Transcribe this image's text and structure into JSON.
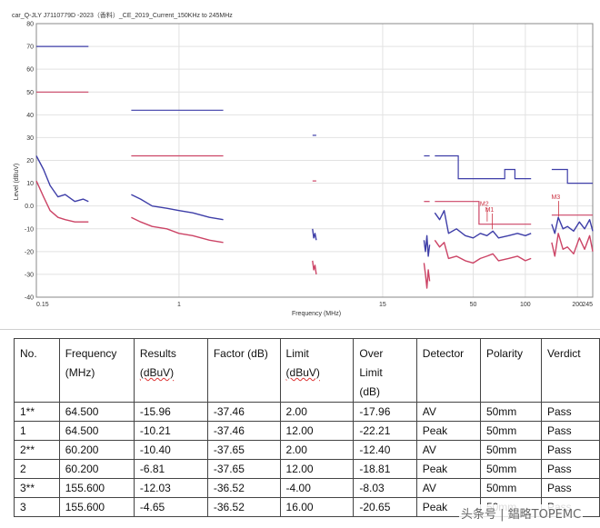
{
  "chart_data": {
    "type": "line",
    "title": "car_Q-JLY J7110779D -2023（香料）_CE_2019_Current_150KHz to 245MHz",
    "xlabel": "Frequency (MHz)",
    "ylabel": "Level (dBuV)",
    "xscale": "log",
    "xlim": [
      0.15,
      245
    ],
    "ylim": [
      -40,
      80
    ],
    "x_ticks": [
      0.15,
      1,
      15,
      50,
      100,
      200,
      245
    ],
    "x_tick_labels": [
      "0.15",
      "1",
      "15",
      "50",
      "100",
      "200",
      "245"
    ],
    "y_ticks": [
      -40,
      -30,
      -20,
      -10,
      0,
      10,
      20,
      30,
      40,
      50,
      60,
      70,
      80
    ],
    "y_tick_labels": [
      "-40",
      "-30",
      "-20",
      "-10",
      "0.0",
      "10",
      "20",
      "30",
      "40",
      "50",
      "60",
      "70",
      "80"
    ],
    "grid": true,
    "colors": {
      "peak": "#3e3ea8",
      "average": "#cc4466",
      "marker": "#cc3344"
    },
    "limit_segments": [
      {
        "series": "peak",
        "points": [
          [
            0.15,
            70
          ],
          [
            0.3,
            70
          ]
        ]
      },
      {
        "series": "average",
        "points": [
          [
            0.15,
            50
          ],
          [
            0.3,
            50
          ]
        ]
      },
      {
        "series": "peak",
        "points": [
          [
            0.53,
            42
          ],
          [
            1.8,
            42
          ]
        ]
      },
      {
        "series": "average",
        "points": [
          [
            0.53,
            22
          ],
          [
            1.8,
            22
          ]
        ]
      },
      {
        "series": "peak",
        "points": [
          [
            5.9,
            31
          ],
          [
            6.2,
            31
          ]
        ]
      },
      {
        "series": "average",
        "points": [
          [
            5.9,
            11
          ],
          [
            6.2,
            11
          ]
        ]
      },
      {
        "series": "peak",
        "points": [
          [
            26,
            22
          ],
          [
            28,
            22
          ]
        ]
      },
      {
        "series": "peak",
        "points": [
          [
            30,
            22
          ],
          [
            41,
            22
          ],
          [
            41,
            12
          ],
          [
            76,
            12
          ],
          [
            76,
            16
          ],
          [
            87,
            16
          ],
          [
            87,
            12
          ],
          [
            108,
            12
          ]
        ]
      },
      {
        "series": "average",
        "points": [
          [
            26,
            2
          ],
          [
            28,
            2
          ]
        ]
      },
      {
        "series": "average",
        "points": [
          [
            30,
            2
          ],
          [
            54,
            2
          ],
          [
            54,
            -8
          ],
          [
            108,
            -8
          ]
        ]
      },
      {
        "series": "peak",
        "points": [
          [
            142,
            16
          ],
          [
            175,
            16
          ],
          [
            175,
            10
          ],
          [
            245,
            10
          ]
        ]
      },
      {
        "series": "average",
        "points": [
          [
            142,
            -4
          ],
          [
            245,
            -4
          ]
        ]
      }
    ],
    "series": [
      {
        "name": "",
        "color": "peak",
        "x": [
          0.15,
          0.165,
          0.18,
          0.2,
          0.22,
          0.25,
          0.28,
          0.3
        ],
        "y": [
          22,
          16,
          9,
          4,
          5,
          2,
          3,
          2
        ]
      },
      {
        "name": "",
        "color": "average",
        "x": [
          0.15,
          0.165,
          0.18,
          0.2,
          0.22,
          0.25,
          0.28,
          0.3
        ],
        "y": [
          11,
          4,
          -2,
          -5,
          -6,
          -7,
          -7,
          -7
        ]
      },
      {
        "name": "",
        "color": "peak",
        "x": [
          0.53,
          0.6,
          0.7,
          0.85,
          1.0,
          1.2,
          1.5,
          1.8
        ],
        "y": [
          5,
          3,
          0,
          -1,
          -2,
          -3,
          -5,
          -6
        ]
      },
      {
        "name": "",
        "color": "average",
        "x": [
          0.53,
          0.6,
          0.7,
          0.85,
          1.0,
          1.2,
          1.5,
          1.8
        ],
        "y": [
          -5,
          -7,
          -9,
          -10,
          -12,
          -13,
          -15,
          -16
        ]
      },
      {
        "name": "",
        "color": "peak",
        "x": [
          5.9,
          6.0,
          6.1,
          6.2
        ],
        "y": [
          -10,
          -14,
          -12,
          -15
        ]
      },
      {
        "name": "",
        "color": "average",
        "x": [
          5.9,
          6.0,
          6.1,
          6.2
        ],
        "y": [
          -24,
          -28,
          -26,
          -30
        ]
      },
      {
        "name": "",
        "color": "peak",
        "x": [
          26,
          26.5,
          27,
          27.5,
          28
        ],
        "y": [
          -15,
          -20,
          -13,
          -22,
          -17
        ]
      },
      {
        "name": "",
        "color": "average",
        "x": [
          26,
          26.5,
          27,
          27.5,
          28
        ],
        "y": [
          -25,
          -30,
          -36,
          -28,
          -33
        ]
      },
      {
        "name": "",
        "color": "peak",
        "x": [
          30,
          32,
          34,
          36,
          40,
          45,
          50,
          55,
          60,
          65,
          70,
          80,
          90,
          100,
          108
        ],
        "y": [
          -3,
          -6,
          -2,
          -12,
          -10,
          -13,
          -14,
          -12,
          -13,
          -11,
          -14,
          -13,
          -12,
          -13,
          -12
        ]
      },
      {
        "name": "",
        "color": "average",
        "x": [
          30,
          32,
          34,
          36,
          40,
          45,
          50,
          55,
          60,
          65,
          70,
          80,
          90,
          100,
          108
        ],
        "y": [
          -15,
          -18,
          -16,
          -23,
          -22,
          -24,
          -25,
          -23,
          -22,
          -21,
          -24,
          -23,
          -22,
          -24,
          -23
        ]
      },
      {
        "name": "",
        "color": "peak",
        "x": [
          142,
          148,
          155,
          165,
          175,
          190,
          205,
          220,
          235,
          245
        ],
        "y": [
          -8,
          -12,
          -5,
          -10,
          -9,
          -11,
          -7,
          -10,
          -6,
          -11
        ]
      },
      {
        "name": "",
        "color": "average",
        "x": [
          142,
          148,
          155,
          165,
          175,
          190,
          205,
          220,
          235,
          245
        ],
        "y": [
          -16,
          -22,
          -12,
          -19,
          -18,
          -21,
          -14,
          -19,
          -13,
          -20
        ]
      }
    ],
    "markers": [
      {
        "label": "M1",
        "x": 64.5,
        "y": -10.21,
        "label_y": -2.5
      },
      {
        "label": "M2",
        "x": 60.2,
        "y": -6.81,
        "label_y": 0
      },
      {
        "label": "M3",
        "x": 155.6,
        "y": -4.65,
        "label_y": 3
      }
    ]
  },
  "table": {
    "headers": [
      [
        "No."
      ],
      [
        "Frequency",
        "(MHz)"
      ],
      [
        "Results",
        "(dBuV)"
      ],
      [
        "Factor (dB)"
      ],
      [
        "Limit",
        "(dBuV)"
      ],
      [
        "Over",
        "Limit",
        "(dB)"
      ],
      [
        "Detector"
      ],
      [
        "Polarity"
      ],
      [
        "Verdict"
      ]
    ],
    "rows": [
      [
        "1**",
        "64.500",
        "-15.96",
        "-37.46",
        "2.00",
        "-17.96",
        "AV",
        "50mm",
        "Pass"
      ],
      [
        "1",
        "64.500",
        "-10.21",
        "-37.46",
        "12.00",
        "-22.21",
        "Peak",
        "50mm",
        "Pass"
      ],
      [
        "2**",
        "60.200",
        "-10.40",
        "-37.65",
        "2.00",
        "-12.40",
        "AV",
        "50mm",
        "Pass"
      ],
      [
        "2",
        "60.200",
        "-6.81",
        "-37.65",
        "12.00",
        "-18.81",
        "Peak",
        "50mm",
        "Pass"
      ],
      [
        "3**",
        "155.600",
        "-12.03",
        "-36.52",
        "-4.00",
        "-8.03",
        "AV",
        "50mm",
        "Pass"
      ],
      [
        "3",
        "155.600",
        "-4.65",
        "-36.52",
        "16.00",
        "-20.65",
        "Peak",
        "50mm",
        "Pass"
      ]
    ]
  },
  "watermark": "头条号 | 錩略TOPEMC"
}
